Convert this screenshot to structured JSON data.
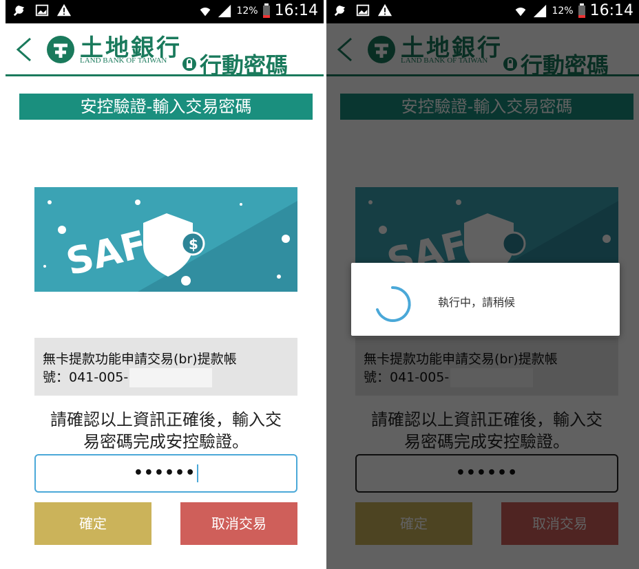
{
  "status_bar": {
    "battery_percent": "12%",
    "time": "16:14"
  },
  "header": {
    "bank_name": "土地銀行",
    "bank_name_en": "LAND BANK OF TAIWAN",
    "mobile_password_label": "行動密碼"
  },
  "page": {
    "title": "安控驗證-輸入交易密碼",
    "banner_text": "SAFE",
    "info_line1": "無卡提款功能申請交易(br)提款帳",
    "info_line2_prefix": "號：041-005-",
    "instruction_line1": "請確認以上資訊正確後，輸入交",
    "instruction_line2": "易密碼完成安控驗證。",
    "password_value": "••••••",
    "confirm_button": "確定",
    "cancel_button": "取消交易"
  },
  "dialog": {
    "message": "執行中，請稍候"
  },
  "colors": {
    "brand_green": "#1a7a5c",
    "title_teal": "#1a8f7e",
    "banner_teal": "#3ba3b4",
    "confirm_gold": "#cbb35a",
    "cancel_red": "#cf5f5a",
    "focus_blue": "#4aa8d8"
  },
  "icons": [
    "wrench-icon",
    "image-icon",
    "warning-icon",
    "wifi-icon",
    "signal-icon",
    "battery-icon",
    "back-chevron-icon",
    "bank-logo-icon",
    "lock-icon",
    "spinner-icon"
  ]
}
